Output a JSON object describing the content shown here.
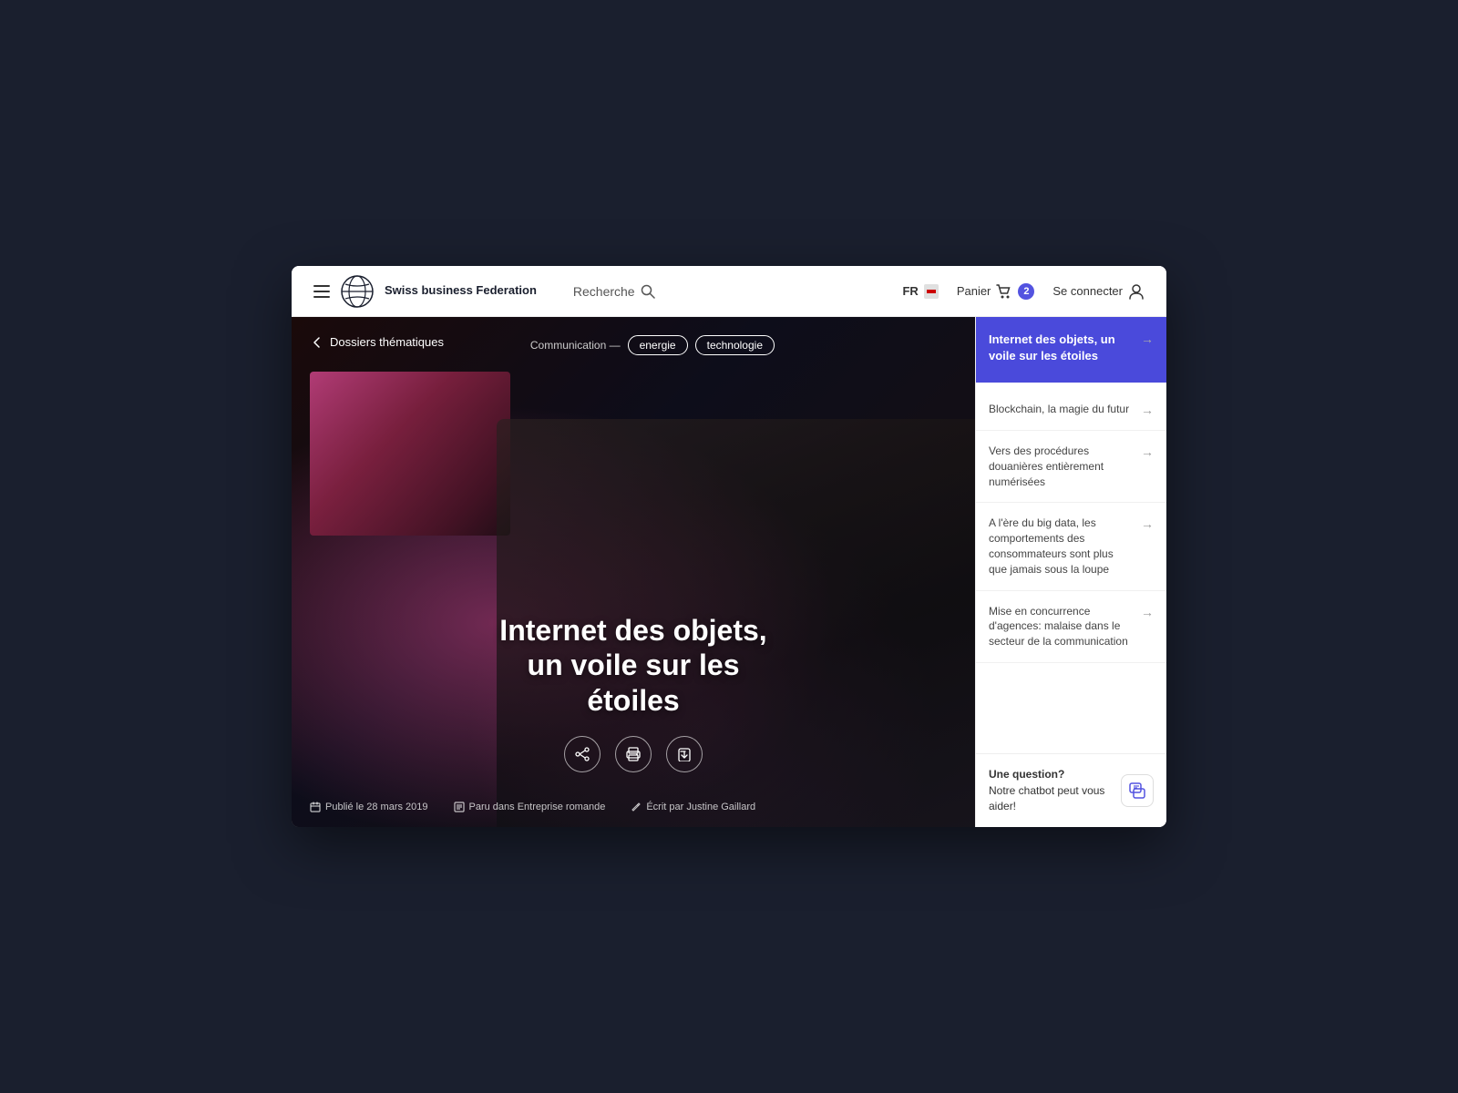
{
  "header": {
    "menu_label": "Menu",
    "logo_alt": "Swiss business Federation logo",
    "brand_name": "Swiss business\nFederation",
    "search_label": "Recherche",
    "lang_label": "FR",
    "cart_label": "Panier",
    "cart_count": "2",
    "connect_label": "Se connecter"
  },
  "hero": {
    "back_label": "Dossiers thématiques",
    "tag_prefix": "Communication —",
    "tags": [
      "energie",
      "technologie"
    ],
    "title": "Internet des objets, un voile sur les étoiles",
    "action_buttons": {
      "share": "share",
      "print": "print",
      "download": "download"
    },
    "footer": {
      "published": "Publié le 28 mars 2019",
      "source": "Paru dans Entreprise romande",
      "author": "Écrit par Justine Gaillard"
    }
  },
  "sidebar": {
    "active_item": {
      "title": "Internet des objets, un voile sur les étoiles"
    },
    "items": [
      {
        "id": 1,
        "text": "Blockchain, la magie du futur"
      },
      {
        "id": 2,
        "text": "Vers des procédures douanières entièrement numérisées"
      },
      {
        "id": 3,
        "text": "A l'ère du big data, les comportements des consommateurs sont plus que jamais sous la loupe"
      },
      {
        "id": 4,
        "text": "Mise en concurrence d'agences: malaise dans le secteur de la communication"
      }
    ],
    "chatbot": {
      "title": "Une question?",
      "subtitle": "Notre chatbot peut vous aider!"
    }
  }
}
